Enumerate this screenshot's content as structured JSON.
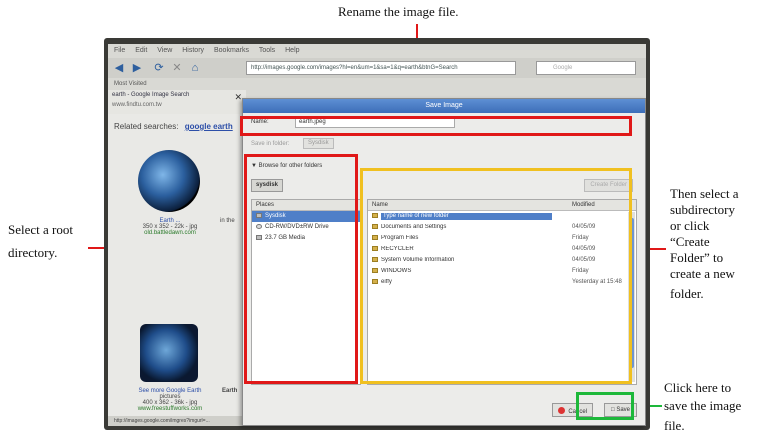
{
  "callouts": {
    "rename": "Rename the image file.",
    "root_line1": "Select a root",
    "root_line2": "directory.",
    "sub_lines": [
      "Then select a",
      "subdirectory",
      "or click",
      "“Create",
      "Folder” to",
      "create a new",
      "folder."
    ],
    "save_lines": [
      "Click here to",
      "save the image",
      "file."
    ]
  },
  "browser": {
    "menu": [
      "File",
      "Edit",
      "View",
      "History",
      "Bookmarks",
      "Tools",
      "Help"
    ],
    "url": "http://images.google.com/images?hl=en&um=1&sa=1&q=earth&btnG=Search",
    "search_placeholder": "Google",
    "bookmarks_label": "Most Visited",
    "tab_title": "earth - Google Image Search",
    "tab_sub": "www.findtu.com.tw",
    "related_label": "Related searches:",
    "related_link": "google earth",
    "thumb1_title": "Earth ...",
    "thumb1_meta": "350 x 352 - 22k - jpg",
    "thumb1_src": "old.battledawn.com",
    "thumb2_title": "See more Google Earth",
    "thumb2_title2": "pictures",
    "thumb2_meta": "400 x 362 - 36k - jpg",
    "thumb2_src": "www.freestuffworks.com",
    "side_text_a": "in the",
    "side_text_b": "Earth",
    "status": "http://images.google.com/imgres?imgurl=..."
  },
  "dialog": {
    "title": "Save Image",
    "name_label": "Name:",
    "name_value": "earth.jpeg",
    "save_in_label": "Save in folder:",
    "save_in_value": "Sysdisk",
    "browse_label": "Browse for other folders",
    "location_button": "sysdisk",
    "create_folder": "Create Folder",
    "places_header": "Places",
    "places": [
      "Sysdisk",
      "CD-RW/DVD±RW Drive",
      "23.7 GB Media"
    ],
    "files_header_name": "Name",
    "files_header_modified": "Modified",
    "files": [
      {
        "name": "Type name of new folder",
        "modified": ""
      },
      {
        "name": "Documents and Settings",
        "modified": "04/05/09"
      },
      {
        "name": "Program Files",
        "modified": "Friday"
      },
      {
        "name": "RECYCLER",
        "modified": "04/05/09"
      },
      {
        "name": "System Volume Information",
        "modified": "04/05/09"
      },
      {
        "name": "WINDOWS",
        "modified": "Friday"
      },
      {
        "name": "eiffy",
        "modified": "Yesterday at 15:48"
      }
    ],
    "cancel_label": "Cancel",
    "save_label": "Save"
  },
  "colors": {
    "highlight_red": "#e01818",
    "highlight_yellow": "#f0c020",
    "highlight_green": "#1db83a"
  }
}
